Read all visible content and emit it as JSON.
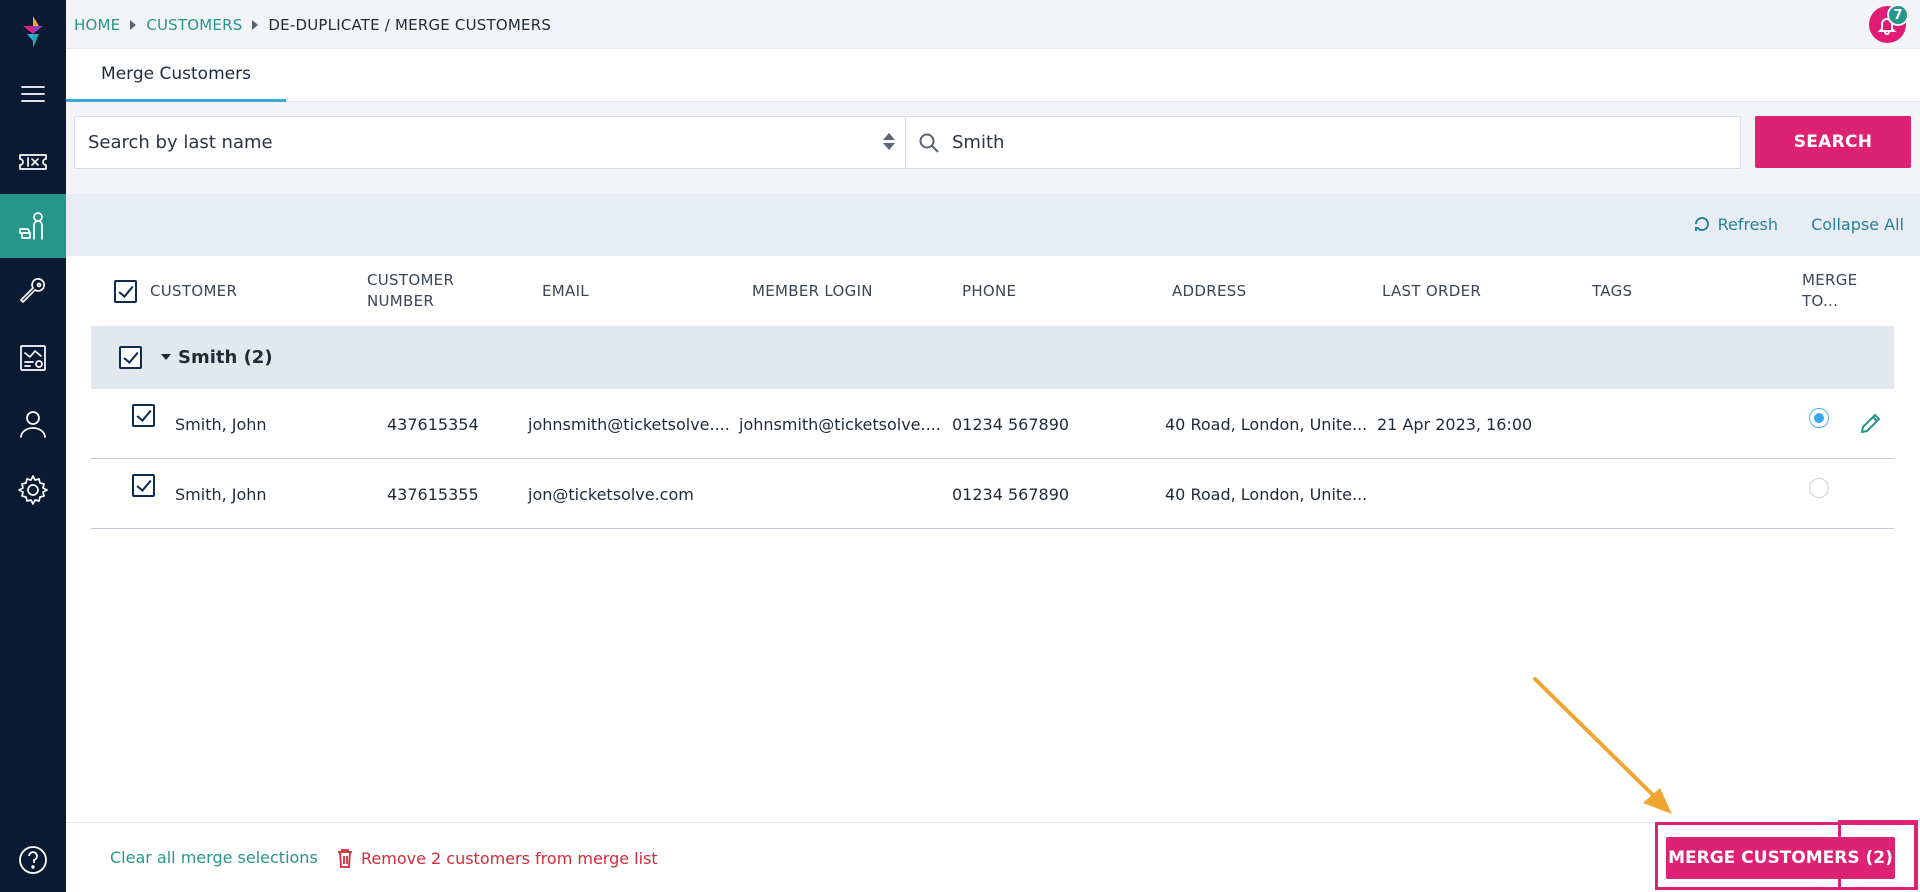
{
  "breadcrumb": {
    "home": "HOME",
    "customers": "CUSTOMERS",
    "current": "DE-DUPLICATE / MERGE CUSTOMERS"
  },
  "notifications": {
    "count": "7",
    "icon": "bell-icon"
  },
  "tabs": [
    {
      "label": "Merge Customers",
      "active": true
    }
  ],
  "search": {
    "mode": "Search by last name",
    "value": "Smith",
    "button": "SEARCH"
  },
  "toolbar": {
    "refresh": "Refresh",
    "collapse_all": "Collapse All"
  },
  "table": {
    "headers": {
      "customer": "CUSTOMER",
      "customer_number_1": "CUSTOMER",
      "customer_number_2": "NUMBER",
      "email": "EMAIL",
      "member_login": "MEMBER LOGIN",
      "phone": "PHONE",
      "address": "ADDRESS",
      "last_order": "LAST ORDER",
      "tags": "TAGS",
      "merge_to_1": "MERGE",
      "merge_to_2": "TO..."
    },
    "group": {
      "label": "Smith (2)",
      "checked": true
    },
    "rows": [
      {
        "name": "Smith, John",
        "number": "437615354",
        "email": "johnsmith@ticketsolve....",
        "member_login": "johnsmith@ticketsolve....",
        "phone": "01234 567890",
        "address": "40 Road, London, Unite...",
        "last_order": "21 Apr 2023, 16:00",
        "tags": "",
        "checked": true,
        "merge_to": true
      },
      {
        "name": "Smith, John",
        "number": "437615355",
        "email": "jon@ticketsolve.com",
        "member_login": "",
        "phone": "01234 567890",
        "address": "40 Road, London, Unite...",
        "last_order": "",
        "tags": "",
        "checked": true,
        "merge_to": false
      }
    ]
  },
  "footer": {
    "clear": "Clear all merge selections",
    "remove": "Remove 2 customers from merge list",
    "merge": "MERGE CUSTOMERS (2)"
  },
  "colors": {
    "sidebar": "#0b1a33",
    "accent_teal": "#27968a",
    "brand_pink": "#dd2273",
    "annotation_arrow": "#f0a531"
  }
}
